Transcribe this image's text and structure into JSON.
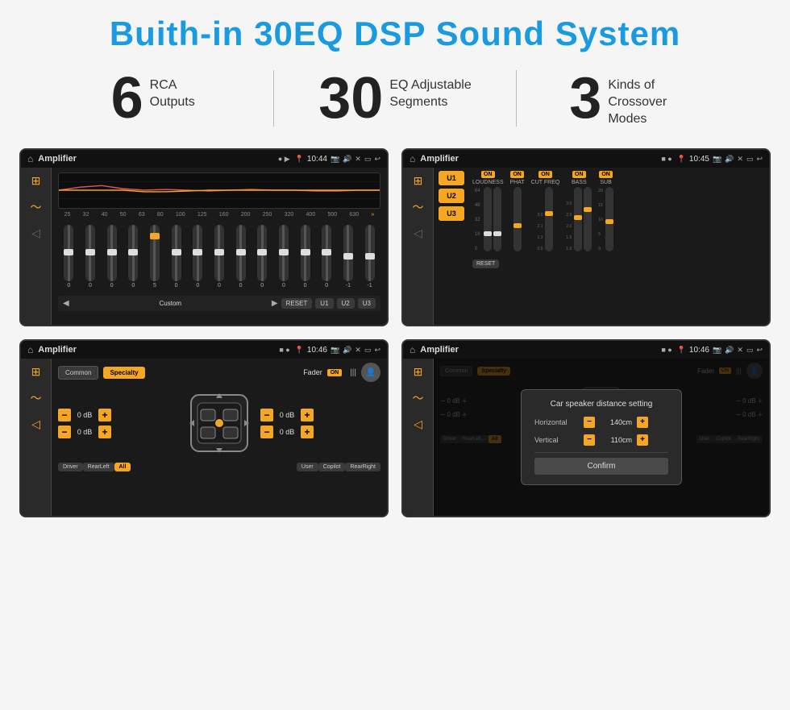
{
  "page": {
    "title": "Buith-in 30EQ DSP Sound System",
    "background": "#f5f5f5"
  },
  "stats": [
    {
      "number": "6",
      "text": "RCA\nOutputs"
    },
    {
      "number": "30",
      "text": "EQ Adjustable\nSegments"
    },
    {
      "number": "3",
      "text": "Kinds of\nCrossover Modes"
    }
  ],
  "screens": [
    {
      "id": "screen1",
      "statusBar": {
        "appName": "Amplifier",
        "time": "10:44",
        "dots": "● ▶"
      }
    },
    {
      "id": "screen2",
      "statusBar": {
        "appName": "Amplifier",
        "time": "10:45",
        "dots": "■ ●"
      }
    },
    {
      "id": "screen3",
      "statusBar": {
        "appName": "Amplifier",
        "time": "10:46",
        "dots": "■ ●"
      }
    },
    {
      "id": "screen4",
      "statusBar": {
        "appName": "Amplifier",
        "time": "10:46",
        "dots": "■ ●"
      }
    }
  ],
  "eq": {
    "frequencies": [
      "25",
      "32",
      "40",
      "50",
      "63",
      "80",
      "100",
      "125",
      "160",
      "200",
      "250",
      "320",
      "400",
      "500",
      "630"
    ],
    "values": [
      "0",
      "0",
      "0",
      "0",
      "5",
      "0",
      "0",
      "0",
      "0",
      "0",
      "0",
      "0",
      "0",
      "-1",
      "0",
      "-1"
    ],
    "preset": "Custom",
    "buttons": [
      "RESET",
      "U1",
      "U2",
      "U3"
    ]
  },
  "crossover": {
    "uButtons": [
      "U1",
      "U2",
      "U3"
    ],
    "channels": [
      "LOUDNESS",
      "PHAT",
      "CUT FREQ",
      "BASS",
      "SUB"
    ],
    "resetLabel": "RESET"
  },
  "fader": {
    "commonLabel": "Common",
    "specialtyLabel": "Specialty",
    "faderLabel": "Fader",
    "onLabel": "ON",
    "leftValues": [
      "0 dB",
      "0 dB"
    ],
    "rightValues": [
      "0 dB",
      "0 dB"
    ],
    "locations": [
      "Driver",
      "RearLeft",
      "All",
      "User",
      "Copilot",
      "RearRight"
    ]
  },
  "dialog": {
    "title": "Car speaker distance setting",
    "horizontalLabel": "Horizontal",
    "horizontalValue": "140cm",
    "verticalLabel": "Vertical",
    "verticalValue": "110cm",
    "confirmLabel": "Confirm"
  }
}
